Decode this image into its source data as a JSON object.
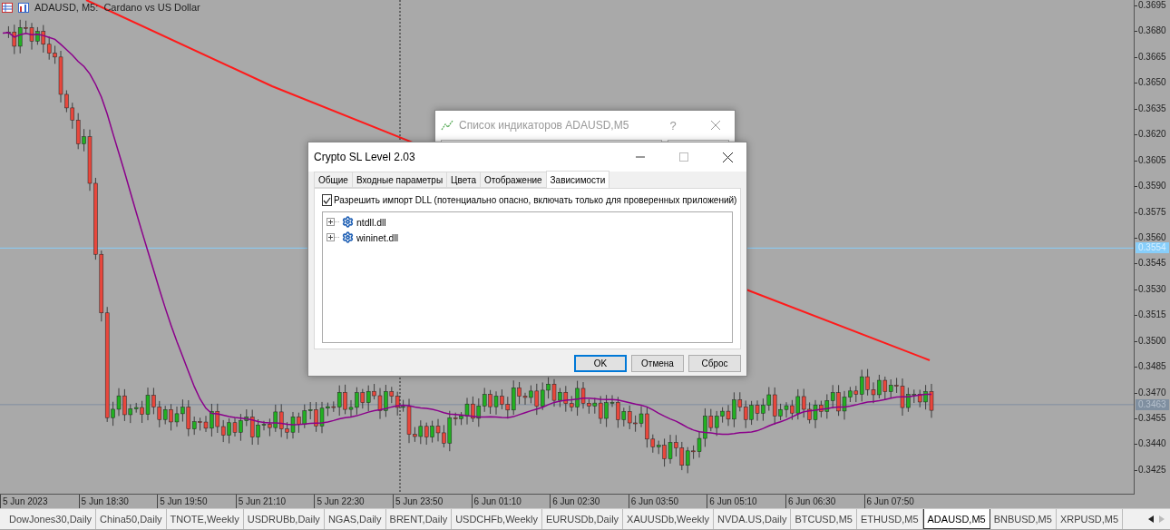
{
  "chart": {
    "title": "ADAUSD, M5:  Cardano vs US Dollar",
    "price_labels": [
      "0.3695",
      "0.3680",
      "0.3665",
      "0.3650",
      "0.3635",
      "0.3620",
      "0.3605",
      "0.3590",
      "0.3575",
      "0.3560",
      "0.3545",
      "0.3530",
      "0.3515",
      "0.3500",
      "0.3485",
      "0.3470",
      "0.3455",
      "0.3440",
      "0.3425"
    ],
    "price_markers": [
      {
        "value": "0.3554",
        "kind": "bid"
      },
      {
        "value": "0.3463",
        "kind": "ask"
      }
    ],
    "time_labels": [
      "5 Jun 2023",
      "5 Jun 18:30",
      "5 Jun 19:50",
      "5 Jun 21:10",
      "5 Jun 22:30",
      "5 Jun 23:50",
      "6 Jun 01:10",
      "6 Jun 02:30",
      "6 Jun 03:50",
      "6 Jun 05:10",
      "6 Jun 06:30",
      "6 Jun 07:50"
    ]
  },
  "back_dialog": {
    "title": "Список индикаторов ADAUSD,M5",
    "help": "?"
  },
  "dialog": {
    "title": "Crypto SL Level 2.03",
    "tabs": [
      {
        "label": "Общие",
        "selected": false
      },
      {
        "label": "Входные параметры",
        "selected": false
      },
      {
        "label": "Цвета",
        "selected": false
      },
      {
        "label": "Отображение",
        "selected": false
      },
      {
        "label": "Зависимости",
        "selected": true
      }
    ],
    "allow_dll": {
      "label": "Разрешить импорт DLL (потенциально опасно, включать только для проверенных приложений)",
      "checked": true
    },
    "dependencies": [
      {
        "name": "ntdll.dll",
        "expanded": false
      },
      {
        "name": "wininet.dll",
        "expanded": false
      }
    ],
    "buttons": [
      {
        "label": "OK",
        "kind": "default"
      },
      {
        "label": "Отмена",
        "kind": "normal"
      },
      {
        "label": "Сброс",
        "kind": "normal"
      }
    ]
  },
  "symbol_tabs": [
    {
      "label": "DowJones30,Daily",
      "selected": false
    },
    {
      "label": "China50,Daily",
      "selected": false
    },
    {
      "label": "TNOTE,Weekly",
      "selected": false
    },
    {
      "label": "USDRUBb,Daily",
      "selected": false
    },
    {
      "label": "NGAS,Daily",
      "selected": false
    },
    {
      "label": "BRENT,Daily",
      "selected": false
    },
    {
      "label": "USDCHFb,Weekly",
      "selected": false
    },
    {
      "label": "EURUSDb,Daily",
      "selected": false
    },
    {
      "label": "XAUUSDb,Weekly",
      "selected": false
    },
    {
      "label": "NVDA.US,Daily",
      "selected": false
    },
    {
      "label": "BTCUSD,M5",
      "selected": false
    },
    {
      "label": "ETHUSD,M5",
      "selected": false
    },
    {
      "label": "ADAUSD,M5",
      "selected": true
    },
    {
      "label": "BNBUSD,M5",
      "selected": false
    },
    {
      "label": "XRPUSD,M5",
      "selected": false
    }
  ]
}
